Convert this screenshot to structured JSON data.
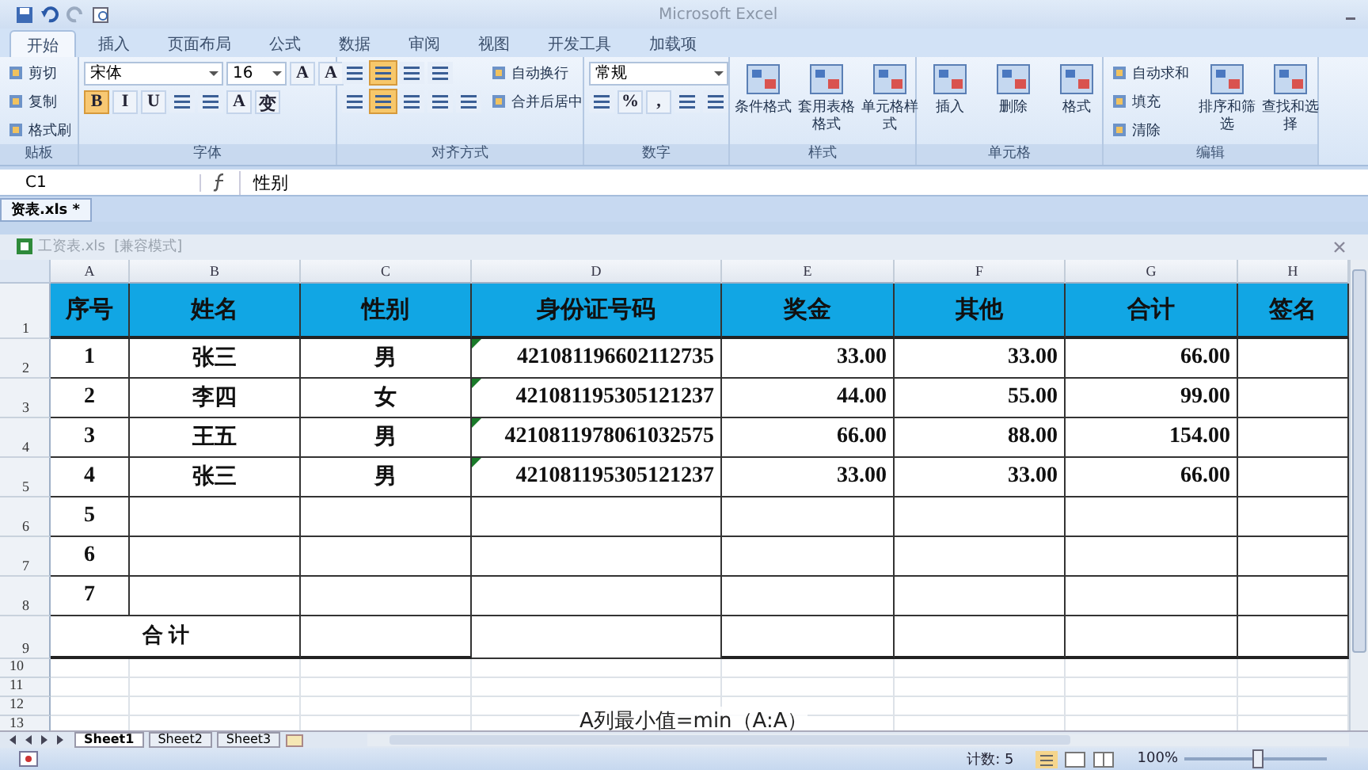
{
  "window": {
    "title": "Microsoft Excel"
  },
  "ribbon_tabs": [
    {
      "label": "开始",
      "selected": true
    },
    {
      "label": "插入",
      "selected": false
    },
    {
      "label": "页面布局",
      "selected": false
    },
    {
      "label": "公式",
      "selected": false
    },
    {
      "label": "数据",
      "selected": false
    },
    {
      "label": "审阅",
      "selected": false
    },
    {
      "label": "视图",
      "selected": false
    },
    {
      "label": "开发工具",
      "selected": false
    },
    {
      "label": "加载项",
      "selected": false
    }
  ],
  "ribbon_groups": [
    {
      "label": "贴板",
      "sections": [
        {
          "kind": "stack",
          "rows": [
            {
              "controls": [
                {
                  "kind": "btn",
                  "text": "剪切"
                }
              ]
            },
            {
              "controls": [
                {
                  "kind": "btn",
                  "text": "复制"
                }
              ]
            },
            {
              "controls": [
                {
                  "kind": "btn",
                  "text": "格式刷"
                }
              ]
            }
          ]
        }
      ]
    },
    {
      "label": "字体",
      "sections": [
        {
          "kind": "stack",
          "rows": [
            {
              "controls": [
                {
                  "kind": "combo",
                  "text": "宋体"
                },
                {
                  "kind": "combo",
                  "text": "16"
                },
                {
                  "kind": "glyph",
                  "text": "A",
                  "on": false
                },
                {
                  "kind": "glyph",
                  "text": "A",
                  "on": false
                }
              ]
            },
            {
              "controls": [
                {
                  "kind": "glyph",
                  "text": "B",
                  "on": true
                },
                {
                  "kind": "glyph",
                  "text": "I",
                  "on": false
                },
                {
                  "kind": "glyph",
                  "text": "U",
                  "on": false
                },
                {
                  "kind": "icon",
                  "on": false
                },
                {
                  "kind": "icon",
                  "on": false
                },
                {
                  "kind": "glyph",
                  "text": "A",
                  "on": false
                },
                {
                  "kind": "glyph",
                  "text": "变",
                  "on": false
                }
              ]
            }
          ]
        }
      ]
    },
    {
      "label": "对齐方式",
      "sections": [
        {
          "kind": "stack",
          "rows": [
            {
              "controls": [
                {
                  "kind": "icon",
                  "on": false
                },
                {
                  "kind": "icon",
                  "on": true
                },
                {
                  "kind": "icon",
                  "on": false
                },
                {
                  "kind": "icon",
                  "on": false
                }
              ]
            },
            {
              "controls": [
                {
                  "kind": "icon",
                  "on": false
                },
                {
                  "kind": "icon",
                  "on": true
                },
                {
                  "kind": "icon",
                  "on": false
                },
                {
                  "kind": "icon",
                  "on": false
                },
                {
                  "kind": "icon",
                  "on": false
                }
              ]
            }
          ]
        },
        {
          "kind": "stack",
          "rows": [
            {
              "controls": [
                {
                  "kind": "btn",
                  "text": "自动换行"
                }
              ]
            },
            {
              "controls": [
                {
                  "kind": "btn",
                  "text": "合并后居中"
                }
              ]
            }
          ]
        }
      ]
    },
    {
      "label": "数字",
      "sections": [
        {
          "kind": "stack",
          "rows": [
            {
              "controls": [
                {
                  "kind": "combo",
                  "text": "常规"
                }
              ]
            },
            {
              "controls": [
                {
                  "kind": "icon",
                  "on": false
                },
                {
                  "kind": "glyph",
                  "text": "%",
                  "on": false
                },
                {
                  "kind": "glyph",
                  "text": ",",
                  "on": false
                },
                {
                  "kind": "icon",
                  "on": false
                },
                {
                  "kind": "icon",
                  "on": false
                }
              ]
            }
          ]
        }
      ]
    },
    {
      "label": "样式",
      "sections": [
        {
          "kind": "large",
          "text": "条件格式"
        },
        {
          "kind": "large",
          "text": "套用表格格式"
        },
        {
          "kind": "large",
          "text": "单元格样式"
        }
      ]
    },
    {
      "label": "单元格",
      "sections": [
        {
          "kind": "large",
          "text": "插入"
        },
        {
          "kind": "large",
          "text": "删除"
        },
        {
          "kind": "large",
          "text": "格式"
        }
      ]
    },
    {
      "label": "编辑",
      "sections": [
        {
          "kind": "stack",
          "rows": [
            {
              "controls": [
                {
                  "kind": "btn",
                  "text": "自动求和"
                }
              ]
            },
            {
              "controls": [
                {
                  "kind": "btn",
                  "text": "填充"
                }
              ]
            },
            {
              "controls": [
                {
                  "kind": "btn",
                  "text": "清除"
                }
              ]
            }
          ]
        },
        {
          "kind": "large",
          "text": "排序和筛选"
        },
        {
          "kind": "large",
          "text": "查找和选择"
        }
      ]
    }
  ],
  "formula_bar": {
    "name_box": "C1",
    "formula": "性别"
  },
  "workbook_tab": "资表.xls *",
  "sheet_window": {
    "title": "工资表.xls  [兼容模式]"
  },
  "columns": [
    "A",
    "B",
    "C",
    "D",
    "E",
    "F",
    "G",
    "H"
  ],
  "rows": [
    {
      "kind": "header",
      "num": "1",
      "cells": [
        "序号",
        "姓名",
        "性别",
        "身份证号码",
        "奖金",
        "其他",
        "合计",
        "签名"
      ]
    },
    {
      "kind": "data",
      "num": "2",
      "cells": [
        "1",
        "张三",
        "男",
        "421081196602112735",
        "33.00",
        "33.00",
        "66.00",
        ""
      ]
    },
    {
      "kind": "data",
      "num": "3",
      "cells": [
        "2",
        "李四",
        "女",
        "421081195305121237",
        "44.00",
        "55.00",
        "99.00",
        ""
      ]
    },
    {
      "kind": "data",
      "num": "4",
      "cells": [
        "3",
        "王五",
        "男",
        "4210811978061032575",
        "66.00",
        "88.00",
        "154.00",
        ""
      ]
    },
    {
      "kind": "data",
      "num": "5",
      "cells": [
        "4",
        "张三",
        "男",
        "421081195305121237",
        "33.00",
        "33.00",
        "66.00",
        ""
      ]
    },
    {
      "kind": "data",
      "num": "6",
      "cells": [
        "5",
        "",
        "",
        "",
        "",
        "",
        "",
        ""
      ]
    },
    {
      "kind": "data",
      "num": "7",
      "cells": [
        "6",
        "",
        "",
        "",
        "",
        "",
        "",
        ""
      ]
    },
    {
      "kind": "data",
      "num": "8",
      "cells": [
        "7",
        "",
        "",
        "",
        "",
        "",
        "",
        ""
      ]
    },
    {
      "kind": "total",
      "num": "9",
      "cells": [
        "合    计",
        "",
        "",
        "",
        "",
        "",
        ""
      ]
    },
    {
      "kind": "blank",
      "num": "10",
      "cells": []
    },
    {
      "kind": "blank",
      "num": "11",
      "cells": []
    },
    {
      "kind": "blank",
      "num": "12",
      "cells": []
    },
    {
      "kind": "blank",
      "num": "13",
      "cells": []
    }
  ],
  "caption": "A列最小值=min（A:A）",
  "sheet_tabs": [
    {
      "label": "Sheet1",
      "selected": true
    },
    {
      "label": "Sheet2",
      "selected": false
    },
    {
      "label": "Sheet3",
      "selected": false
    }
  ],
  "status_bar": {
    "count": "计数: 5",
    "zoom": "100%",
    "zoom_slider": {
      "level": 0.5
    }
  }
}
